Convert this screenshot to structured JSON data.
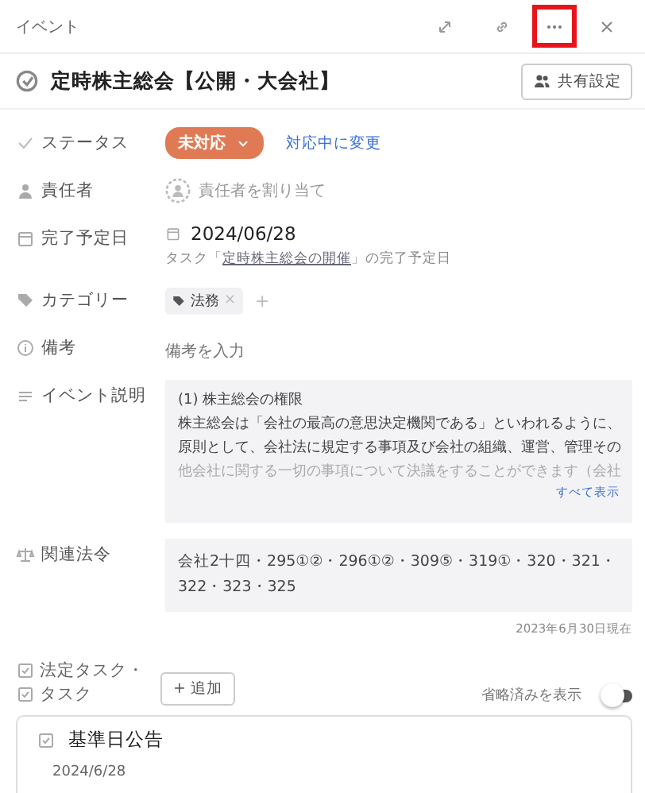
{
  "header": {
    "title": "イベント",
    "more_highlighted": true
  },
  "event": {
    "title": "定時株主総会【公開・大会社】",
    "share_button": "共有設定"
  },
  "status": {
    "label": "ステータス",
    "value": "未対応",
    "color": "#e07a55",
    "action": "対応中に変更"
  },
  "owner": {
    "label": "責任者",
    "placeholder": "責任者を割り当て"
  },
  "due": {
    "label": "完了予定日",
    "date": "2024/06/28",
    "note_before": "タスク「",
    "note_link": "定時株主総会の開催",
    "note_after": "」の完了予定日"
  },
  "category": {
    "label": "カテゴリー",
    "tags": [
      {
        "label": "法務",
        "remove": "×"
      }
    ],
    "add": "+"
  },
  "remarks": {
    "label": "備考",
    "placeholder": "備考を入力"
  },
  "description": {
    "label": "イベント説明",
    "lines": [
      "(1) 株主総会の権限",
      "株主総会は「会社の最高の意思決定機関である」といわれるように、",
      "原則として、会社法に規定する事項及び会社の組織、運営、管理その",
      "他会社に関する一切の事項について決議をすることができます（会社"
    ],
    "show_all": "すべて表示"
  },
  "laws": {
    "label": "関連法令",
    "text": "会社2十四・295①②・296①②・309⑤・319①・320・321・322・323・325",
    "as_of": "2023年6月30日現在"
  },
  "tasks": {
    "label_1": "法定タスク・",
    "label_2": "タスク",
    "add": "+ 追加",
    "toggle_label": "省略済みを表示",
    "toggle_on": false,
    "items": [
      {
        "title": "基準日公告",
        "date": "2024/6/28"
      }
    ]
  }
}
